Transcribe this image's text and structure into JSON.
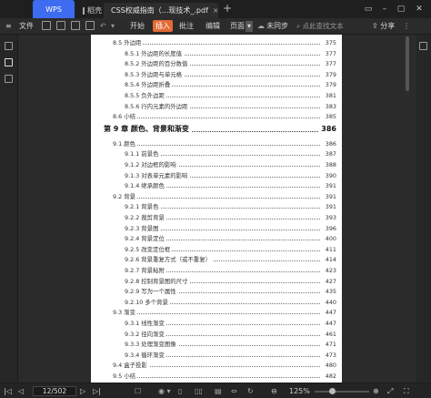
{
  "titlebar": {
    "tabs": [
      {
        "label": "WPS"
      },
      {
        "label": "稻壳"
      },
      {
        "label": "CSS权威指南（...现技术_.pdf"
      }
    ],
    "close_glyph": "×",
    "new_tab_glyph": "+",
    "window_controls": [
      "▭",
      "–",
      "▢",
      "✕"
    ]
  },
  "toolbar": {
    "menu_label": "文件",
    "tabs": [
      "开始",
      "插入",
      "批注",
      "编辑",
      "页面"
    ],
    "active_tab": "插入",
    "sync_label": "未同步",
    "search_placeholder": "点此查找文本",
    "share_label": "分享",
    "accent_color": "#e46a35"
  },
  "toc": {
    "entries": [
      {
        "title": "8.5 外边距",
        "page": "375",
        "level": 1
      },
      {
        "title": "8.5.1 外边距的长度值",
        "page": "377",
        "level": 2
      },
      {
        "title": "8.5.2 外边距的百分数值",
        "page": "377",
        "level": 2
      },
      {
        "title": "8.5.3 外边距与单元格",
        "page": "379",
        "level": 2
      },
      {
        "title": "8.5.4 外边距折叠",
        "page": "379",
        "level": 2
      },
      {
        "title": "8.5.5 负外边距",
        "page": "381",
        "level": 2
      },
      {
        "title": "8.5.6 行内元素的外边距",
        "page": "383",
        "level": 2
      },
      {
        "title": "8.6 小结",
        "page": "385",
        "level": 1
      },
      {
        "title": "第 9 章  颜色、背景和渐变",
        "page": "386",
        "level": 0
      },
      {
        "title": "9.1 颜色",
        "page": "386",
        "level": 1
      },
      {
        "title": "9.1.1 前景色",
        "page": "387",
        "level": 2
      },
      {
        "title": "9.1.2 对边框的影响",
        "page": "388",
        "level": 2
      },
      {
        "title": "9.1.3 对表单元素的影响",
        "page": "390",
        "level": 2
      },
      {
        "title": "9.1.4 继承颜色",
        "page": "391",
        "level": 2
      },
      {
        "title": "9.2 背景",
        "page": "391",
        "level": 1
      },
      {
        "title": "9.2.1 背景色",
        "page": "391",
        "level": 2
      },
      {
        "title": "9.2.2 裁剪背景",
        "page": "393",
        "level": 2
      },
      {
        "title": "9.2.3 背景图",
        "page": "396",
        "level": 2
      },
      {
        "title": "9.2.4 背景定位",
        "page": "400",
        "level": 2
      },
      {
        "title": "9.2.5 改变定位框",
        "page": "411",
        "level": 2
      },
      {
        "title": "9.2.6 背景重复方式（或不重复）",
        "page": "414",
        "level": 2
      },
      {
        "title": "9.2.7 背景粘附",
        "page": "423",
        "level": 2
      },
      {
        "title": "9.2.8 控制背景图的尺寸",
        "page": "427",
        "level": 2
      },
      {
        "title": "9.2.9 写为一个属性",
        "page": "435",
        "level": 2
      },
      {
        "title": "9.2.10 多个背景",
        "page": "440",
        "level": 2
      },
      {
        "title": "9.3 渐变",
        "page": "447",
        "level": 1
      },
      {
        "title": "9.3.1 线性渐变",
        "page": "447",
        "level": 2
      },
      {
        "title": "9.3.2 径向渐变",
        "page": "461",
        "level": 2
      },
      {
        "title": "9.3.3 处理渐变图像",
        "page": "471",
        "level": 2
      },
      {
        "title": "9.3.4 循环渐变",
        "page": "473",
        "level": 2
      },
      {
        "title": "9.4 盒子投影",
        "page": "480",
        "level": 1
      },
      {
        "title": "9.5 小结",
        "page": "482",
        "level": 1
      }
    ]
  },
  "statusbar": {
    "page_indicator": "12/502",
    "zoom_label": "125%",
    "first_glyph": "|◁",
    "prev_glyph": "◁",
    "next_glyph": "▷",
    "last_glyph": "▷|"
  }
}
